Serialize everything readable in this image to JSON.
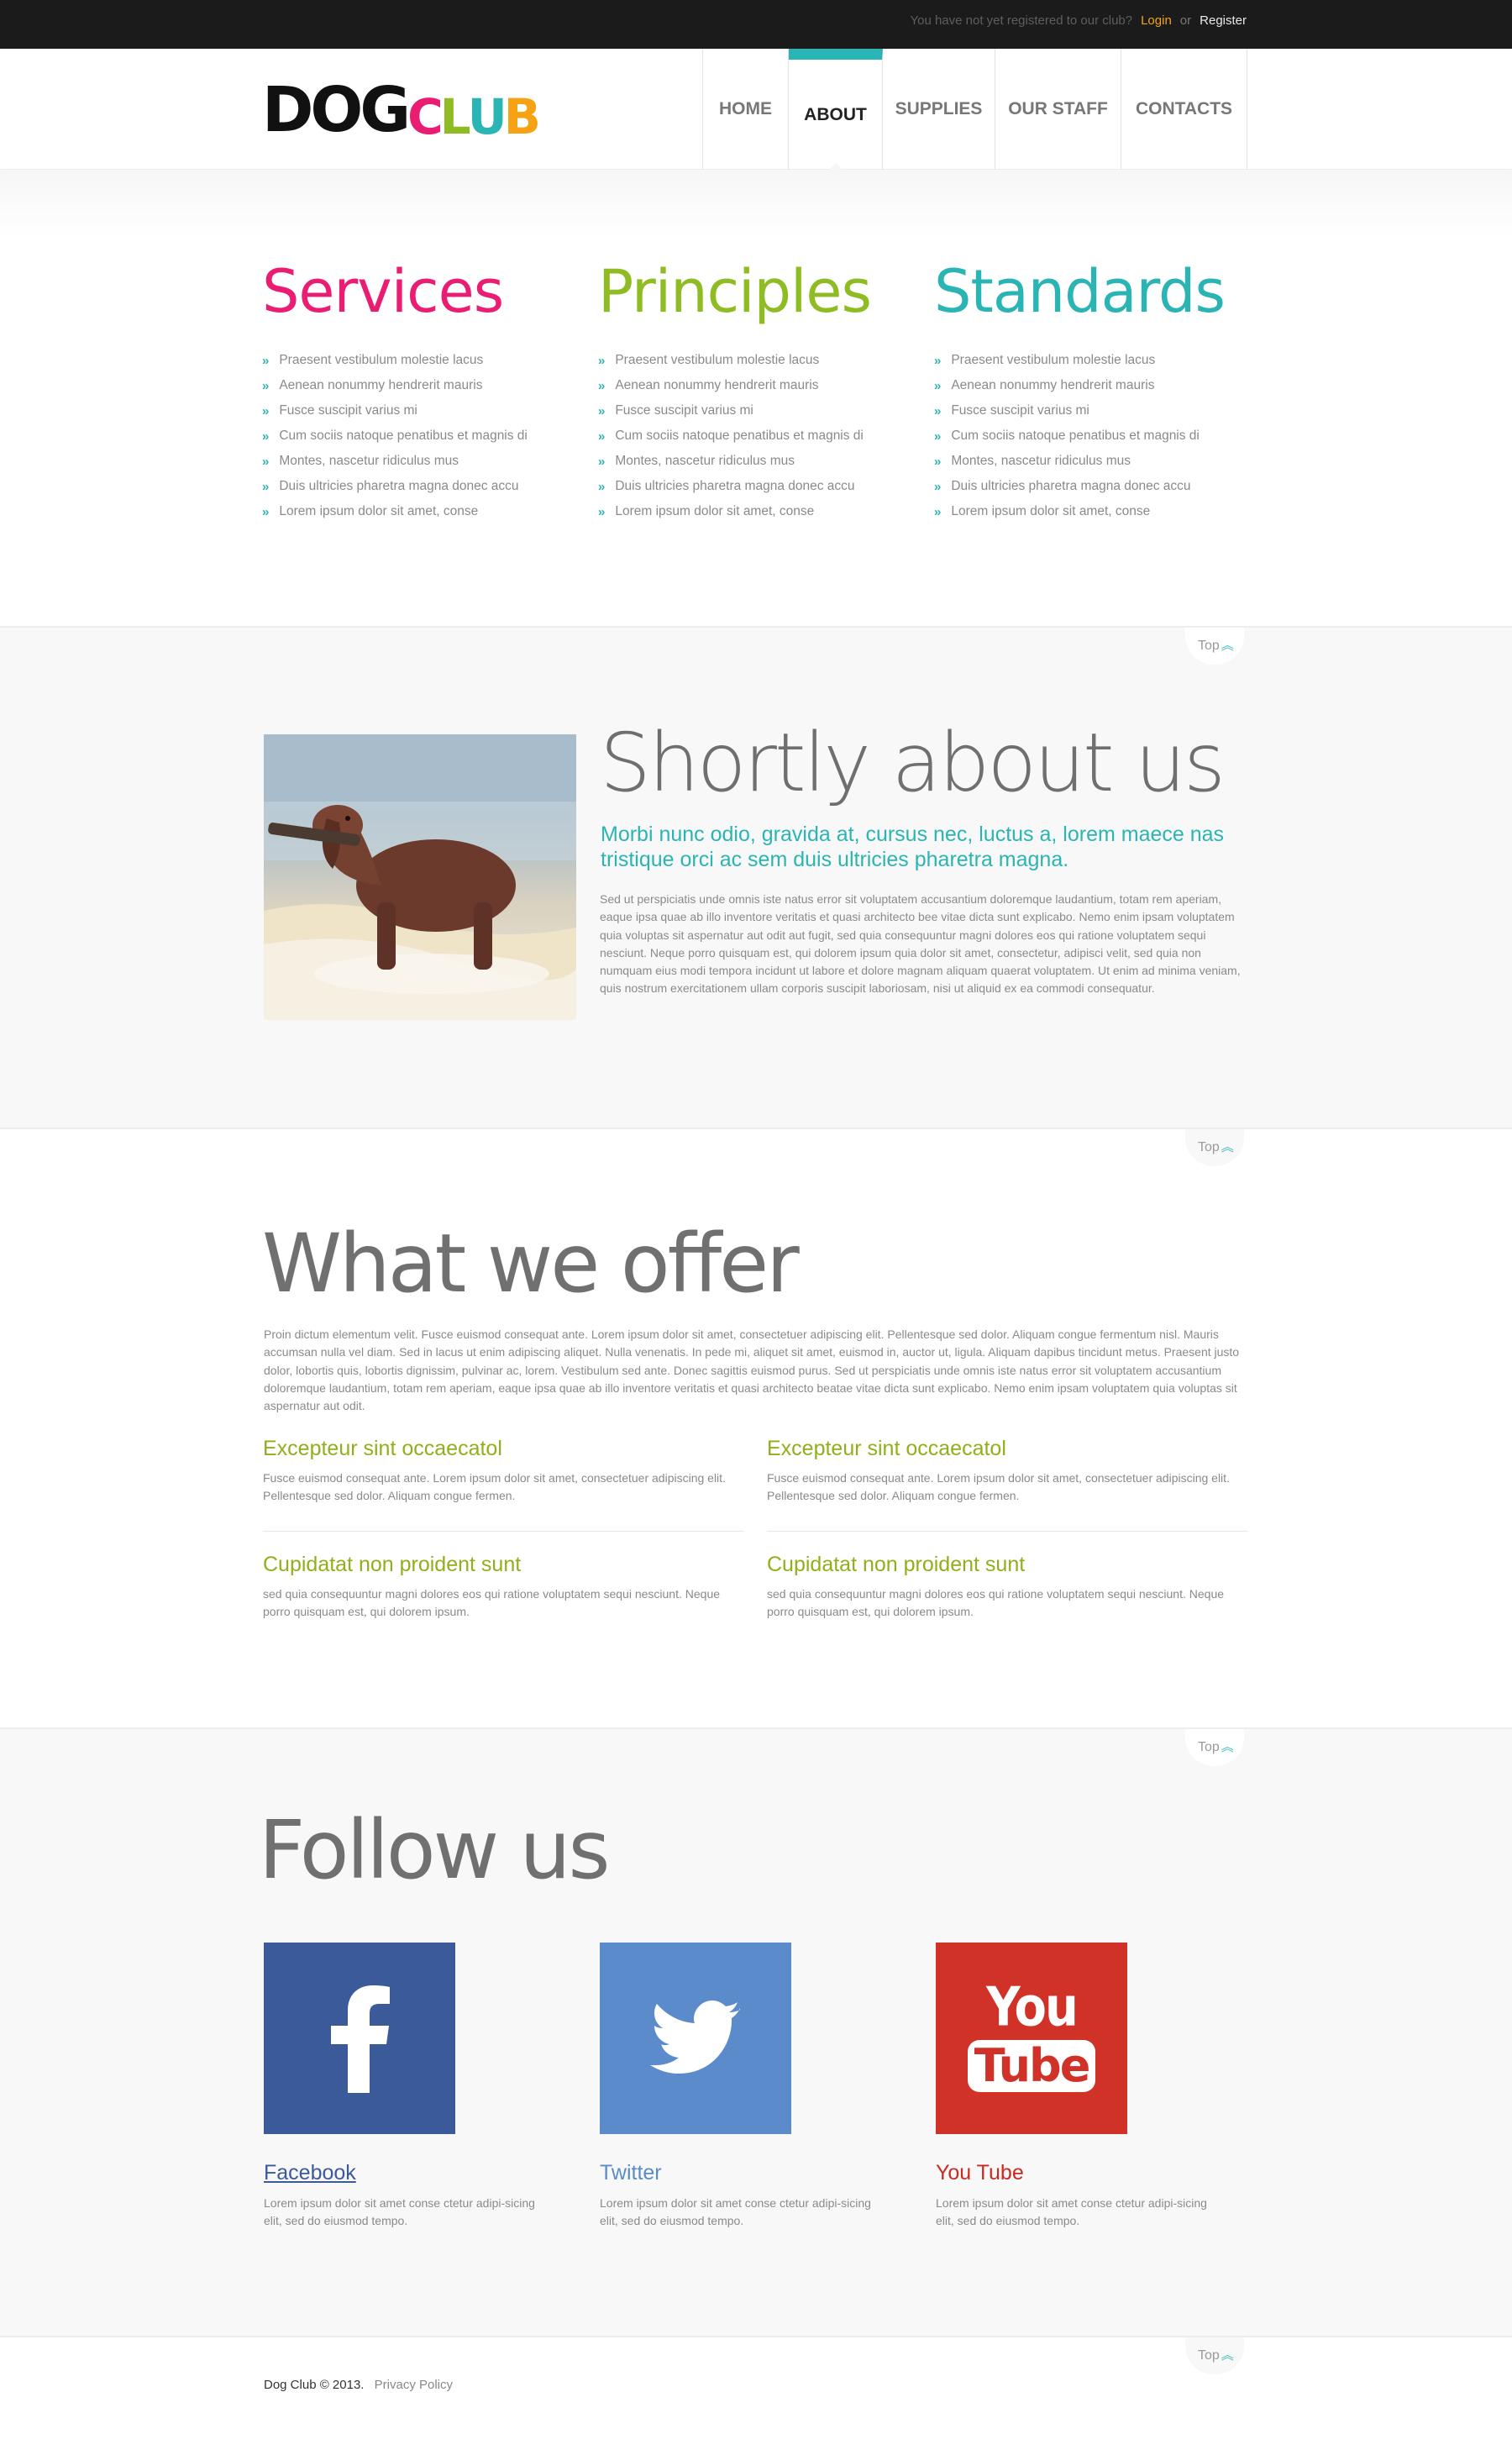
{
  "topbar": {
    "note": "You have not yet registered to our club?",
    "login": "Login",
    "or": "or",
    "register": "Register"
  },
  "logo": {
    "dog": "DOG",
    "c": "C",
    "l": "L",
    "u": "U",
    "b": "B"
  },
  "nav": [
    {
      "label": "HOME",
      "active": false
    },
    {
      "label": "ABOUT",
      "active": true
    },
    {
      "label": "SUPPLIES",
      "active": false
    },
    {
      "label": "OUR STAFF",
      "active": false
    },
    {
      "label": "CONTACTS",
      "active": false
    }
  ],
  "top_link_label": "Top",
  "columns": [
    {
      "title": "Services",
      "color": "#e91e73",
      "items": [
        "Praesent vestibulum molestie lacus",
        "Aenean nonummy hendrerit mauris",
        "Fusce suscipit varius mi",
        "Cum sociis natoque penatibus et magnis di",
        "Montes, nascetur ridiculus mus",
        "Duis ultricies pharetra magna donec accu",
        "Lorem ipsum dolor sit amet, conse"
      ]
    },
    {
      "title": "Principles",
      "color": "#8fbc23",
      "items": [
        "Praesent vestibulum molestie lacus",
        "Aenean nonummy hendrerit mauris",
        "Fusce suscipit varius mi",
        "Cum sociis natoque penatibus et magnis di",
        "Montes, nascetur ridiculus mus",
        "Duis ultricies pharetra magna donec accu",
        "Lorem ipsum dolor sit amet, conse"
      ]
    },
    {
      "title": "Standards",
      "color": "#2ab5b4",
      "items": [
        "Praesent vestibulum molestie lacus",
        "Aenean nonummy hendrerit mauris",
        "Fusce suscipit varius mi",
        "Cum sociis natoque penatibus et magnis di",
        "Montes, nascetur ridiculus mus",
        "Duis ultricies pharetra magna donec accu",
        "Lorem ipsum dolor sit amet, conse"
      ]
    }
  ],
  "about": {
    "title": "Shortly about us",
    "lead": "Morbi nunc odio, gravida at, cursus nec, luctus a, lorem  maece nas tristique orci ac sem duis ultricies pharetra magna.",
    "body": "Sed ut perspiciatis unde omnis iste natus error sit voluptatem accusantium doloremque laudantium, totam rem aperiam, eaque ipsa quae ab illo inventore veritatis et quasi architecto bee vitae dicta sunt explicabo. Nemo enim ipsam voluptatem quia voluptas sit aspernatur aut odit aut fugit, sed quia consequuntur magni dolores eos qui ratione voluptatem sequi nesciunt. Neque porro quisquam est, qui dolorem ipsum quia dolor sit amet, consectetur, adipisci velit, sed quia non numquam eius modi tempora incidunt ut labore et dolore magnam aliquam quaerat voluptatem. Ut enim ad minima veniam, quis nostrum exercitationem ullam corporis suscipit laboriosam, nisi ut aliquid ex ea commodi consequatur."
  },
  "offer": {
    "title": "What we offer",
    "body": "Proin dictum elementum velit. Fusce euismod consequat ante. Lorem ipsum dolor sit amet, consectetuer adipiscing elit. Pellentesque sed dolor. Aliquam congue fermentum nisl. Mauris accumsan nulla vel diam. Sed in lacus ut enim adipiscing aliquet. Nulla venenatis. In pede mi, aliquet sit amet, euismod in, auctor ut, ligula. Aliquam dapibus tincidunt metus. Praesent justo dolor, lobortis quis, lobortis dignissim, pulvinar ac, lorem. Vestibulum sed ante. Donec sagittis euismod purus. Sed ut perspiciatis unde omnis iste natus error sit voluptatem accusantium doloremque laudantium, totam rem aperiam, eaque ipsa quae ab illo inventore veritatis et quasi architecto beatae vitae dicta sunt explicabo. Nemo enim ipsam voluptatem quia voluptas sit aspernatur aut odit.",
    "features": [
      {
        "title": "Excepteur sint occaecatol",
        "text": "Fusce euismod consequat ante. Lorem ipsum dolor sit amet, consectetuer adipiscing elit. Pellentesque sed dolor. Aliquam congue fermen."
      },
      {
        "title": "Excepteur sint occaecatol",
        "text": "Fusce euismod consequat ante. Lorem ipsum dolor sit amet, consectetuer adipiscing elit. Pellentesque sed dolor. Aliquam congue fermen."
      },
      {
        "title": "Cupidatat non proident sunt",
        "text": "sed quia consequuntur magni dolores eos qui ratione voluptatem sequi nesciunt. Neque porro quisquam est, qui dolorem ipsum."
      },
      {
        "title": "Cupidatat non proident sunt",
        "text": "sed quia consequuntur magni dolores eos qui ratione voluptatem sequi nesciunt. Neque porro quisquam est, qui dolorem ipsum."
      }
    ]
  },
  "follow": {
    "title": "Follow us",
    "networks": [
      {
        "name": "Facebook",
        "icon": "facebook-icon",
        "color": "#3a5a9a",
        "text_color": "#3a5a9a",
        "text": "Lorem ipsum dolor sit amet conse ctetur adipi-sicing elit, sed do eiusmod tempo."
      },
      {
        "name": "Twitter",
        "icon": "twitter-icon",
        "color": "#5b8bca",
        "text_color": "#5b8bca",
        "text": "Lorem ipsum dolor sit amet conse ctetur adipi-sicing elit, sed do eiusmod tempo."
      },
      {
        "name": "You Tube",
        "icon": "youtube-icon",
        "color": "#d13228",
        "text_color": "#c92a22",
        "text": "Lorem ipsum dolor sit amet conse ctetur adipi-sicing elit, sed do eiusmod tempo."
      }
    ],
    "youtube_logo": {
      "you": "You",
      "tube": "Tube"
    }
  },
  "footer": {
    "copyright": "Dog Club © 2013.",
    "privacy": "Privacy Policy"
  }
}
